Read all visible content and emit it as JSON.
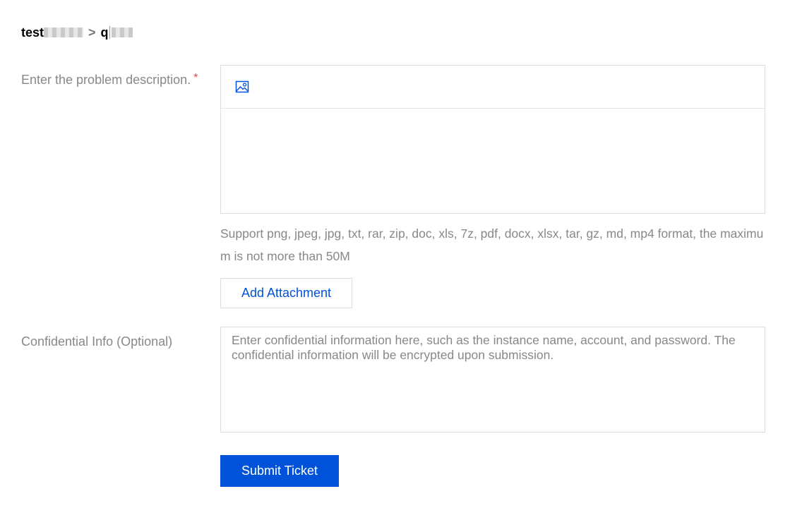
{
  "breadcrumb": {
    "parent": "test",
    "separator": ">",
    "current": "q"
  },
  "form": {
    "description_label": "Enter the problem description.",
    "required_mark": "*",
    "toolbar": {
      "image_icon": "image-insert-icon"
    },
    "support_text": "Support png, jpeg, jpg, txt, rar, zip, doc, xls, 7z, pdf, docx, xlsx, tar, gz, md, mp4 format, the maximum is not more than 50M",
    "add_attachment_label": "Add Attachment",
    "confidential_label": "Confidential Info (Optional)",
    "confidential_placeholder": "Enter confidential information here, such as the instance name, account, and password. The confidential information will be encrypted upon submission.",
    "confidential_value": "",
    "submit_label": "Submit Ticket"
  },
  "colors": {
    "primary": "#0052d9",
    "label_gray": "#888888",
    "border": "#dddddd",
    "required_red": "#e54545"
  }
}
